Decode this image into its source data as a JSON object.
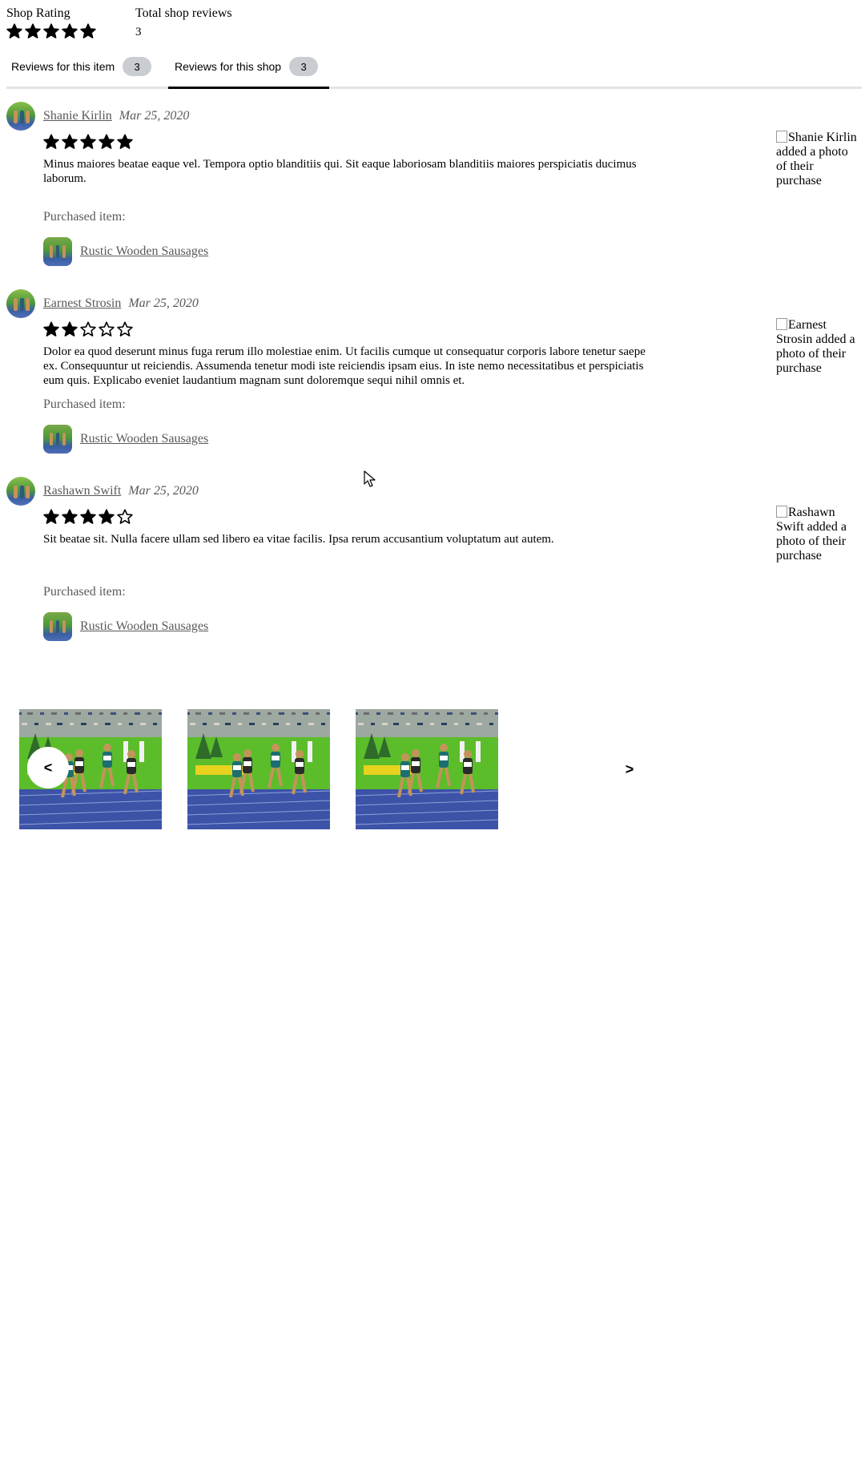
{
  "header": {
    "shop_rating_label": "Shop Rating",
    "shop_rating_stars": 5,
    "total_reviews_label": "Total shop reviews",
    "total_reviews_value": "3"
  },
  "tabs": [
    {
      "label": "Reviews for this item",
      "count": "3",
      "active": false
    },
    {
      "label": "Reviews for this shop",
      "count": "3",
      "active": true
    }
  ],
  "reviews": [
    {
      "name": "Shanie Kirlin",
      "date": "Mar 25, 2020",
      "rating": 5,
      "text": "Minus maiores beatae eaque vel. Tempora optio blanditiis qui. Sit eaque laboriosam blanditiis maiores perspiciatis ducimus laborum.",
      "purchased_label": "Purchased item:",
      "item": "Rustic Wooden Sausages",
      "photo_alt": "Shanie Kirlin added a photo of their purchase"
    },
    {
      "name": "Earnest Strosin",
      "date": "Mar 25, 2020",
      "rating": 2,
      "text": "Dolor ea quod deserunt minus fuga rerum illo molestiae enim. Ut facilis cumque ut consequatur corporis labore tenetur saepe ex. Consequuntur ut reiciendis. Assumenda tenetur modi iste reiciendis ipsam eius. In iste nemo necessitatibus et perspiciatis eum quis. Explicabo eveniet laudantium magnam sunt doloremque sequi nihil omnis et.",
      "purchased_label": "Purchased item:",
      "item": "Rustic Wooden Sausages",
      "photo_alt": "Earnest Strosin added a photo of their purchase"
    },
    {
      "name": "Rashawn Swift",
      "date": "Mar 25, 2020",
      "rating": 4,
      "text": "Sit beatae sit. Nulla facere ullam sed libero ea vitae facilis. Ipsa rerum accusantium voluptatum aut autem.",
      "purchased_label": "Purchased item:",
      "item": "Rustic Wooden Sausages",
      "photo_alt": "Rashawn Swift added a photo of their purchase"
    }
  ],
  "carousel": {
    "prev_label": "<",
    "next_label": ">",
    "photo_count": 3
  },
  "colors": {
    "star": "#000000",
    "muted_text": "#595959",
    "badge_bg": "#c9cdd2",
    "tab_underline": "#e3e3e3"
  }
}
